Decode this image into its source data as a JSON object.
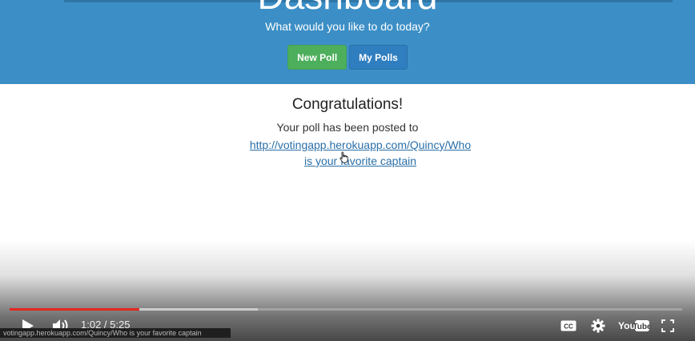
{
  "header": {
    "title": "Dashboard",
    "subtitle": "What would you like to do today?",
    "buttons": {
      "new_poll": "New Poll",
      "my_polls": "My Polls"
    },
    "colors": {
      "background": "#3c8fc6",
      "new_poll": "#4daf5c",
      "my_polls": "#2f7ec0"
    }
  },
  "main": {
    "title": "Congratulations!",
    "message": "Your poll has been posted to",
    "link_line1": "http://votingapp.herokuapp.com/Quincy/Who",
    "link_line2": "is your favorite captain"
  },
  "player": {
    "time": "1:02 / 5:25",
    "played_fraction": 0.193,
    "buffered_fraction": 0.369,
    "status_url": "votingapp.herokuapp.com/Quincy/Who is your favorite captain",
    "icons": [
      "play-icon",
      "volume-icon",
      "cc-icon",
      "settings-icon",
      "youtube-logo",
      "fullscreen-icon"
    ],
    "colors": {
      "progress": "#e52620"
    }
  }
}
